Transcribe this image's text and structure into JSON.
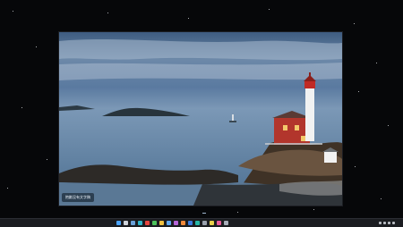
{
  "photo": {
    "caption": "抱歉没有文字稿"
  },
  "taskbar": {
    "icons": [
      {
        "name": "start-icon",
        "color": "#4aa3ff"
      },
      {
        "name": "search-icon",
        "color": "#cfd3da"
      },
      {
        "name": "widgets-icon",
        "color": "#6aa0d8"
      },
      {
        "name": "edge-icon",
        "color": "#2fb5c9"
      },
      {
        "name": "app-red-icon",
        "color": "#e5463f"
      },
      {
        "name": "app-green-icon",
        "color": "#4cc25c"
      },
      {
        "name": "folder-icon",
        "color": "#f0c040"
      },
      {
        "name": "store-icon",
        "color": "#5fa8f0"
      },
      {
        "name": "app-purple-icon",
        "color": "#b565d8"
      },
      {
        "name": "app-orange-icon",
        "color": "#f08a3c"
      },
      {
        "name": "app-blue-icon",
        "color": "#3b7be0"
      },
      {
        "name": "app-teal-icon",
        "color": "#27b6a6"
      },
      {
        "name": "terminal-icon",
        "color": "#9aa1ad"
      },
      {
        "name": "app-yellow-icon",
        "color": "#e8d04a"
      },
      {
        "name": "app-pink-icon",
        "color": "#e85a9a"
      },
      {
        "name": "settings-icon",
        "color": "#a7adb8"
      }
    ],
    "clock_time": "",
    "clock_date": ""
  }
}
